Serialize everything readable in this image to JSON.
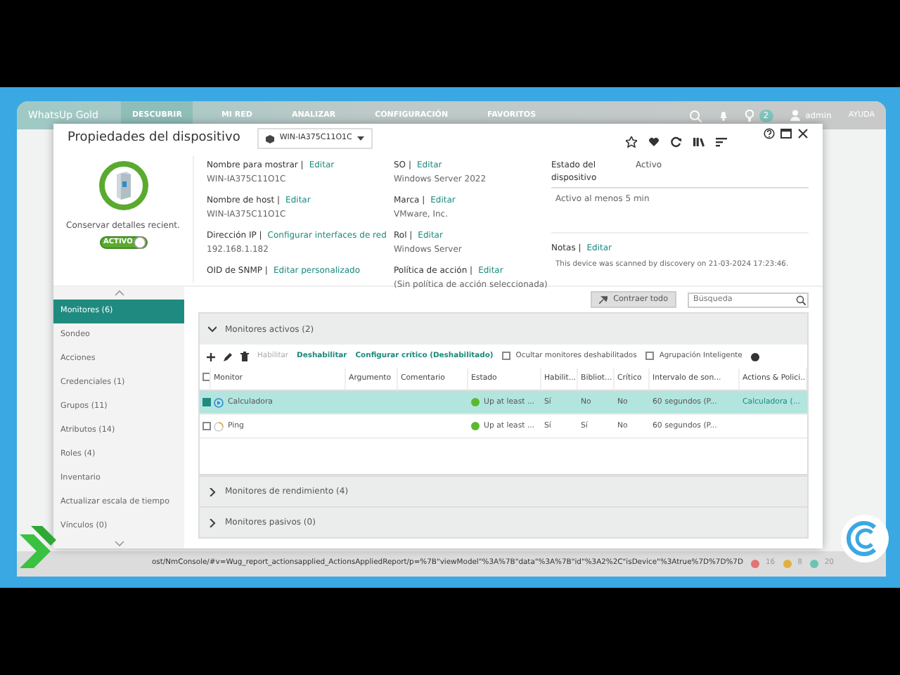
{
  "app": {
    "logo": "WhatsUp Gold",
    "nav": [
      {
        "label": "DESCUBRIR",
        "selected": true
      },
      {
        "label": "MI RED",
        "selected": false
      },
      {
        "label": "ANALIZAR",
        "selected": false
      },
      {
        "label": "CONFIGURACIÓN",
        "selected": false
      },
      {
        "label": "FAVORITOS",
        "selected": false
      }
    ],
    "alerts_count": "2",
    "user": "admin",
    "help": "AYUDA"
  },
  "dialog": {
    "title": "Propiedades del dispositivo",
    "device": "WIN-IA375C11O1C",
    "keep_details": {
      "label": "Conservar detalles recient.",
      "toggle_label": "ACTIVO",
      "on": true
    },
    "fields_1": [
      {
        "label": "Nombre para mostrar |",
        "link": "Editar",
        "value": "WIN-IA375C11O1C"
      },
      {
        "label": "Nombre de host |",
        "link": "Editar",
        "value": "WIN-IA375C11O1C"
      },
      {
        "label": "Dirección IP |",
        "link": "Configurar interfaces de red",
        "value": "192.168.1.182"
      },
      {
        "label": "OID de SNMP |",
        "link": "Editar personalizado"
      }
    ],
    "fields_2": [
      {
        "label": "SO |",
        "link": "Editar",
        "value": "Windows Server 2022"
      },
      {
        "label": "Marca |",
        "link": "Editar",
        "value": "VMware, Inc."
      },
      {
        "label": "Rol |",
        "link": "Editar",
        "value": "Windows Server"
      },
      {
        "label": "Política de acción |",
        "link": "Editar",
        "value": "(Sin política de acción seleccionada)"
      }
    ],
    "state": {
      "label": "Estado del dispositivo",
      "value": "Activo",
      "detail": "Activo al menos 5 min"
    },
    "notes": {
      "label": "Notas |",
      "link": "Editar",
      "text": "This device was scanned by discovery on 21-03-2024 17:23:46."
    },
    "sidebar": [
      {
        "label": "Monitores (6)",
        "selected": true
      },
      {
        "label": "Sondeo",
        "selected": false
      },
      {
        "label": "Acciones",
        "selected": false
      },
      {
        "label": "Credenciales (1)",
        "selected": false
      },
      {
        "label": "Grupos (11)",
        "selected": false
      },
      {
        "label": "Atributos (14)",
        "selected": false
      },
      {
        "label": "Roles (4)",
        "selected": false
      },
      {
        "label": "Inventario",
        "selected": false
      },
      {
        "label": "Actualizar escala de tiempo",
        "selected": false
      },
      {
        "label": "Vínculos (0)",
        "selected": false
      }
    ],
    "collapse_button": "Contraer todo",
    "search": {
      "placeholder": "Búsqueda"
    },
    "sections": [
      {
        "title": "Monitores activos (2)",
        "expanded": true
      },
      {
        "title": "Monitores de rendimiento (4)",
        "expanded": false
      },
      {
        "title": "Monitores pasivos (0)",
        "expanded": false
      }
    ],
    "actions": [
      {
        "label": "Habilitar",
        "disabled": true
      },
      {
        "label": "Deshabilitar",
        "disabled": false
      },
      {
        "label": "Configurar crítico (Deshabilitado)",
        "disabled": false
      }
    ],
    "options": [
      {
        "label": "Ocultar monitores deshabilitados",
        "checked": false
      },
      {
        "label": "Agrupación Inteligente",
        "checked": false
      }
    ],
    "table": {
      "all_checked": false,
      "columns": [
        "Monitor",
        "Argumento",
        "Comentario",
        "Estado",
        "Habilit...",
        "Bibliot...",
        "Crítico",
        "Intervalo de son...",
        "Actions & Polici..."
      ],
      "rows": [
        {
          "selected": true,
          "checked": true,
          "kind": "active",
          "cells": [
            "Calculadora",
            "",
            "",
            "Up at least ...",
            "Sí",
            "No",
            "No",
            "60 segundos (P...",
            "Calculadora (..."
          ],
          "color": "#5cb82e"
        },
        {
          "selected": false,
          "checked": false,
          "kind": "pending",
          "cells": [
            "Ping",
            "",
            "",
            "Up at least ...",
            "Sí",
            "Sí",
            "No",
            "60 segundos (P...",
            ""
          ],
          "color": "#5cb82e"
        }
      ]
    }
  },
  "status_bar": {
    "url": "ost/NmConsole/#v=Wug_report_actionsapplied_ActionsAppliedReport/p=%7B\"viewModel\"%3A%7B\"data\"%3A%7B\"id\"%3A2%2C\"isDevice\"%3Atrue%7D%7D%7D",
    "counts": [
      "16",
      "8",
      "20"
    ]
  }
}
